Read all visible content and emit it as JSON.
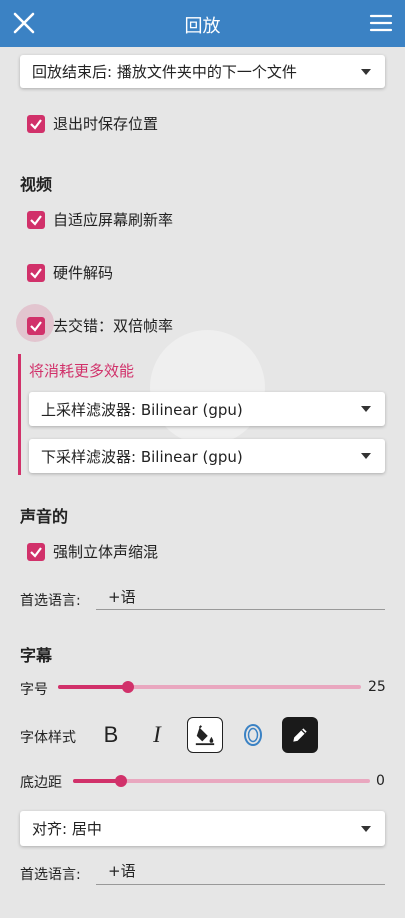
{
  "appbar": {
    "title": "回放"
  },
  "playback": {
    "end_action": "回放结束后: 播放文件夹中的下一个文件",
    "save_position_label": "退出时保存位置"
  },
  "video": {
    "section_title": "视频",
    "adaptive_refresh_label": "自适应屏幕刷新率",
    "hw_decode_label": "硬件解码",
    "deinterlace_label": "去交错：双倍帧率",
    "warning": "将消耗更多效能",
    "upscale_filter": "上采样滤波器: Bilinear (gpu)",
    "downscale_filter": "下采样滤波器: Bilinear (gpu)"
  },
  "audio": {
    "section_title": "声音的",
    "force_stereo_label": "强制立体声缩混",
    "pref_lang_label": "首选语言:",
    "pref_lang_value": "+语"
  },
  "subtitles": {
    "section_title": "字幕",
    "font_size_label": "字号",
    "font_size_value": "25",
    "font_size_fraction": 0.23,
    "font_style_label": "字体样式",
    "bold_glyph": "B",
    "italic_glyph": "I",
    "bottom_margin_label": "底边距",
    "bottom_margin_value": "0",
    "bottom_margin_fraction": 0.16,
    "align": "对齐: 居中",
    "pref_lang_label": "首选语言:",
    "pref_lang_value": "+语"
  },
  "colors": {
    "appbar": "#3b82c4",
    "accent": "#d1316a",
    "background": "#e6e6e6"
  },
  "icons": [
    "close-icon",
    "menu-icon",
    "check-icon",
    "caret-down-icon",
    "fill-color-icon",
    "outline-text-icon",
    "pen-icon"
  ]
}
